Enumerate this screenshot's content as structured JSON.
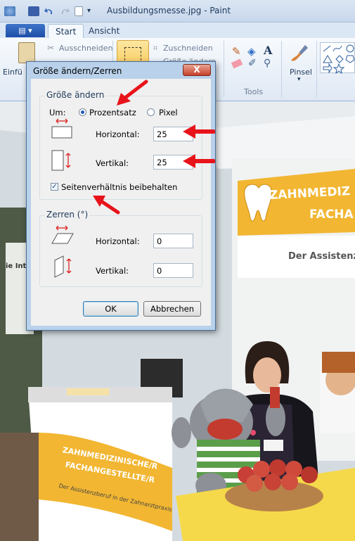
{
  "window": {
    "title": "Ausbildungsmesse.jpg - Paint"
  },
  "ribbon": {
    "file_tab": "▤ ▾",
    "tabs": [
      "Start",
      "Ansicht"
    ],
    "clipboard": {
      "paste_label": "Einfü",
      "cut_label": "Ausschneiden"
    },
    "image": {
      "crop_label": "Zuschneiden",
      "resize_label": "Größe ändern"
    },
    "tools_group_label": "Tools",
    "brush_label": "Pinsel",
    "brush_caret": "▾"
  },
  "dialog": {
    "title": "Größe ändern/Zerren",
    "close_symbol": "X",
    "resize_group": {
      "label": "Größe ändern",
      "by_label": "Um:",
      "option_percent": "Prozentsatz",
      "option_pixel": "Pixel",
      "selected": "Prozentsatz",
      "horizontal_label": "Horizontal:",
      "horizontal_value": "25",
      "vertical_label": "Vertikal:",
      "vertical_value": "25",
      "keep_ratio_label": "Seitenverhältnis beibehalten",
      "keep_ratio_checked": true,
      "check_mark": "✓"
    },
    "skew_group": {
      "label": "Zerren (°)",
      "horizontal_label": "Horizontal:",
      "horizontal_value": "0",
      "vertical_label": "Vertikal:",
      "vertical_value": "0"
    },
    "ok_label": "OK",
    "cancel_label": "Abbrechen"
  },
  "photo": {
    "banner_top": "ZAHNMEDIZ",
    "banner_top2": "FACHA",
    "banner_sub": "Der Assistenzb",
    "left_sign": "ie Inte",
    "table_banner_line1": "ZAHNMEDIZINISCHE/R",
    "table_banner_line2": "FACHANGESTELLTE/R",
    "table_banner_line3": "Der Assistenzberuf in der Zahnarztpraxis"
  },
  "colors": {
    "annotation_arrow": "#e8131a",
    "dialog_frame": "#b9d1ea",
    "banner_yellow": "#f2b632"
  }
}
